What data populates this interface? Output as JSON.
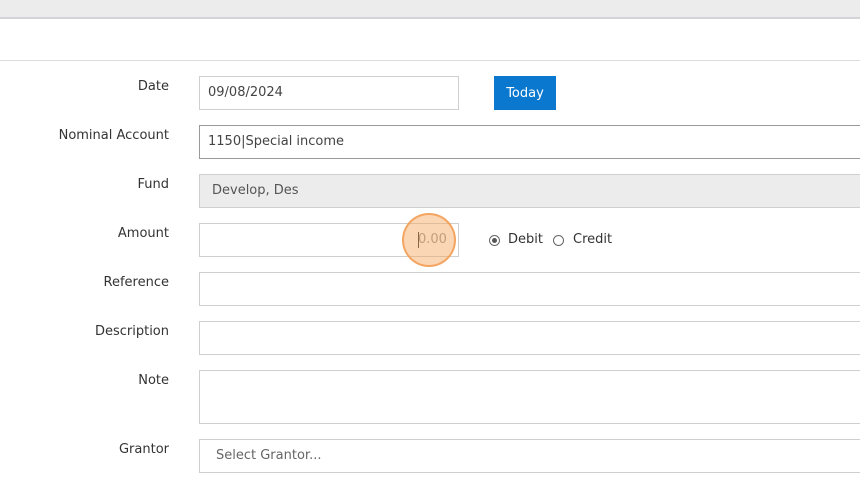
{
  "form": {
    "date": {
      "label": "Date",
      "value": "09/08/2024",
      "today_button": "Today"
    },
    "nominal_account": {
      "label": "Nominal Account",
      "value": "1150|Special income"
    },
    "fund": {
      "label": "Fund",
      "value": "Develop, Des"
    },
    "amount": {
      "label": "Amount",
      "placeholder": "0.00",
      "options": [
        {
          "label": "Debit",
          "checked": true
        },
        {
          "label": "Credit",
          "checked": false
        }
      ]
    },
    "reference": {
      "label": "Reference",
      "value": ""
    },
    "description": {
      "label": "Description",
      "value": ""
    },
    "note": {
      "label": "Note",
      "value": ""
    },
    "grantor": {
      "label": "Grantor",
      "placeholder": "Select Grantor..."
    }
  },
  "colors": {
    "accent": "#0a78cf",
    "click_indicator": "#f7a45c"
  }
}
